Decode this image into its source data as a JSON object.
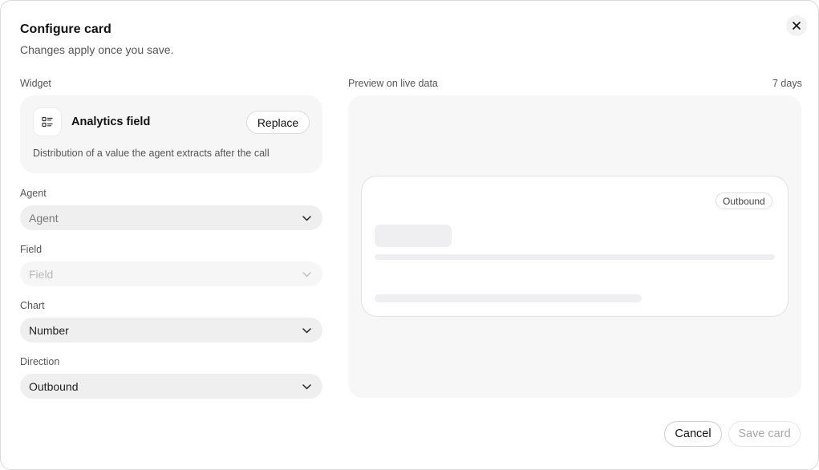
{
  "dialog": {
    "title": "Configure card",
    "subtitle": "Changes apply once you save.",
    "close_icon": "close-icon"
  },
  "widget": {
    "label": "Widget",
    "icon": "list-icon",
    "name": "Analytics field",
    "replace_label": "Replace",
    "description": "Distribution of a value the agent extracts after the call"
  },
  "fields": {
    "agent": {
      "label": "Agent",
      "value": "Agent"
    },
    "field": {
      "label": "Field",
      "value": "Field",
      "disabled": true
    },
    "chart": {
      "label": "Chart",
      "value": "Number"
    },
    "direction": {
      "label": "Direction",
      "value": "Outbound"
    }
  },
  "preview": {
    "label": "Preview on live data",
    "range": "7 days",
    "tag": "Outbound"
  },
  "footer": {
    "cancel_label": "Cancel",
    "save_label": "Save card"
  }
}
